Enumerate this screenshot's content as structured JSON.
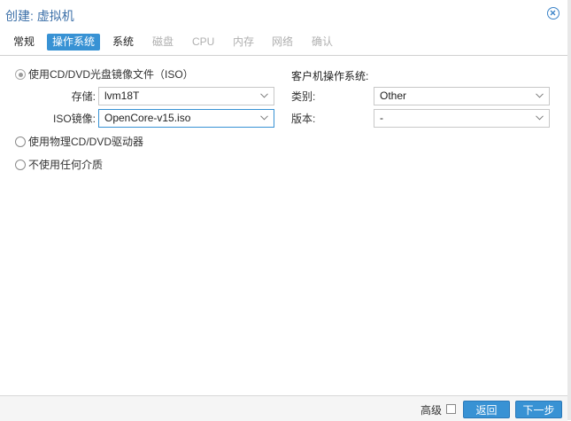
{
  "window": {
    "title": "创建: 虚拟机"
  },
  "tabs": [
    {
      "label": "常规",
      "state": "enabled"
    },
    {
      "label": "操作系统",
      "state": "active"
    },
    {
      "label": "系统",
      "state": "enabled"
    },
    {
      "label": "磁盘",
      "state": "disabled"
    },
    {
      "label": "CPU",
      "state": "disabled"
    },
    {
      "label": "内存",
      "state": "disabled"
    },
    {
      "label": "网络",
      "state": "disabled"
    },
    {
      "label": "确认",
      "state": "disabled"
    }
  ],
  "media": {
    "option_iso": "使用CD/DVD光盘镜像文件（ISO）",
    "option_physical": "使用物理CD/DVD驱动器",
    "option_none": "不使用任何介质",
    "selected": "option_iso",
    "storage_label": "存储:",
    "storage_value": "lvm18T",
    "iso_label": "ISO镜像:",
    "iso_value": "OpenCore-v15.iso"
  },
  "guest_os": {
    "heading": "客户机操作系统:",
    "type_label": "类别:",
    "type_value": "Other",
    "version_label": "版本:",
    "version_value": "-"
  },
  "footer": {
    "advanced_label": "高级",
    "advanced_checked": false,
    "back_label": "返回",
    "next_label": "下一步"
  },
  "colors": {
    "accent": "#3892d4",
    "title": "#3b6fa8"
  }
}
